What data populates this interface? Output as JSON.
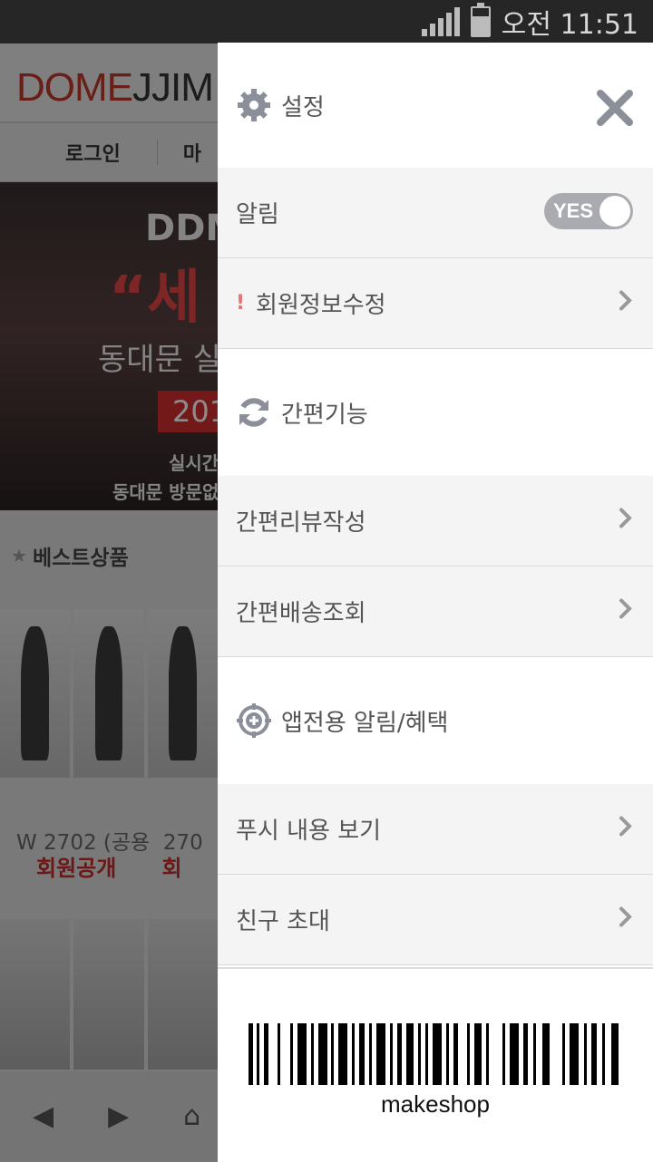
{
  "status_bar": {
    "time": "오전 11:51"
  },
  "background_app": {
    "logo_red": "DOME",
    "logo_dark": "JJIM",
    "nav": [
      "로그인",
      "마"
    ],
    "banner": {
      "line1": "DDM",
      "line2": "“세",
      "line3": "동대문 실",
      "line4": "201",
      "line5": "실시간",
      "line6": "동대문 방문없"
    },
    "best_label": "베스트상품",
    "product_code": "W 2702 (공용",
    "product_code2": "270",
    "product_price": "회원공개",
    "product_price2": "회"
  },
  "drawer": {
    "header": {
      "icon": "gear-icon",
      "title": "설정",
      "close_icon": "close-icon"
    },
    "notification": {
      "label": "알림",
      "toggle_label": "YES",
      "enabled": true
    },
    "profile_edit": {
      "label": "회원정보수정",
      "alert_mark": "!"
    },
    "section_quick": {
      "icon": "refresh-icon",
      "title": "간편기능"
    },
    "quick_items": [
      {
        "label": "간편리뷰작성"
      },
      {
        "label": "간편배송조회"
      }
    ],
    "section_app": {
      "icon": "target-plus-icon",
      "title": "앱전용 알림/혜택"
    },
    "app_items": [
      {
        "label": "푸시 내용 보기"
      },
      {
        "label": "친구 초대"
      }
    ],
    "footer": {
      "brand": "makeshop"
    }
  },
  "colors": {
    "accent_red": "#c0392b",
    "toggle_grey": "#a9abb0",
    "row_grey": "#f4f4f4",
    "text": "#555555"
  }
}
